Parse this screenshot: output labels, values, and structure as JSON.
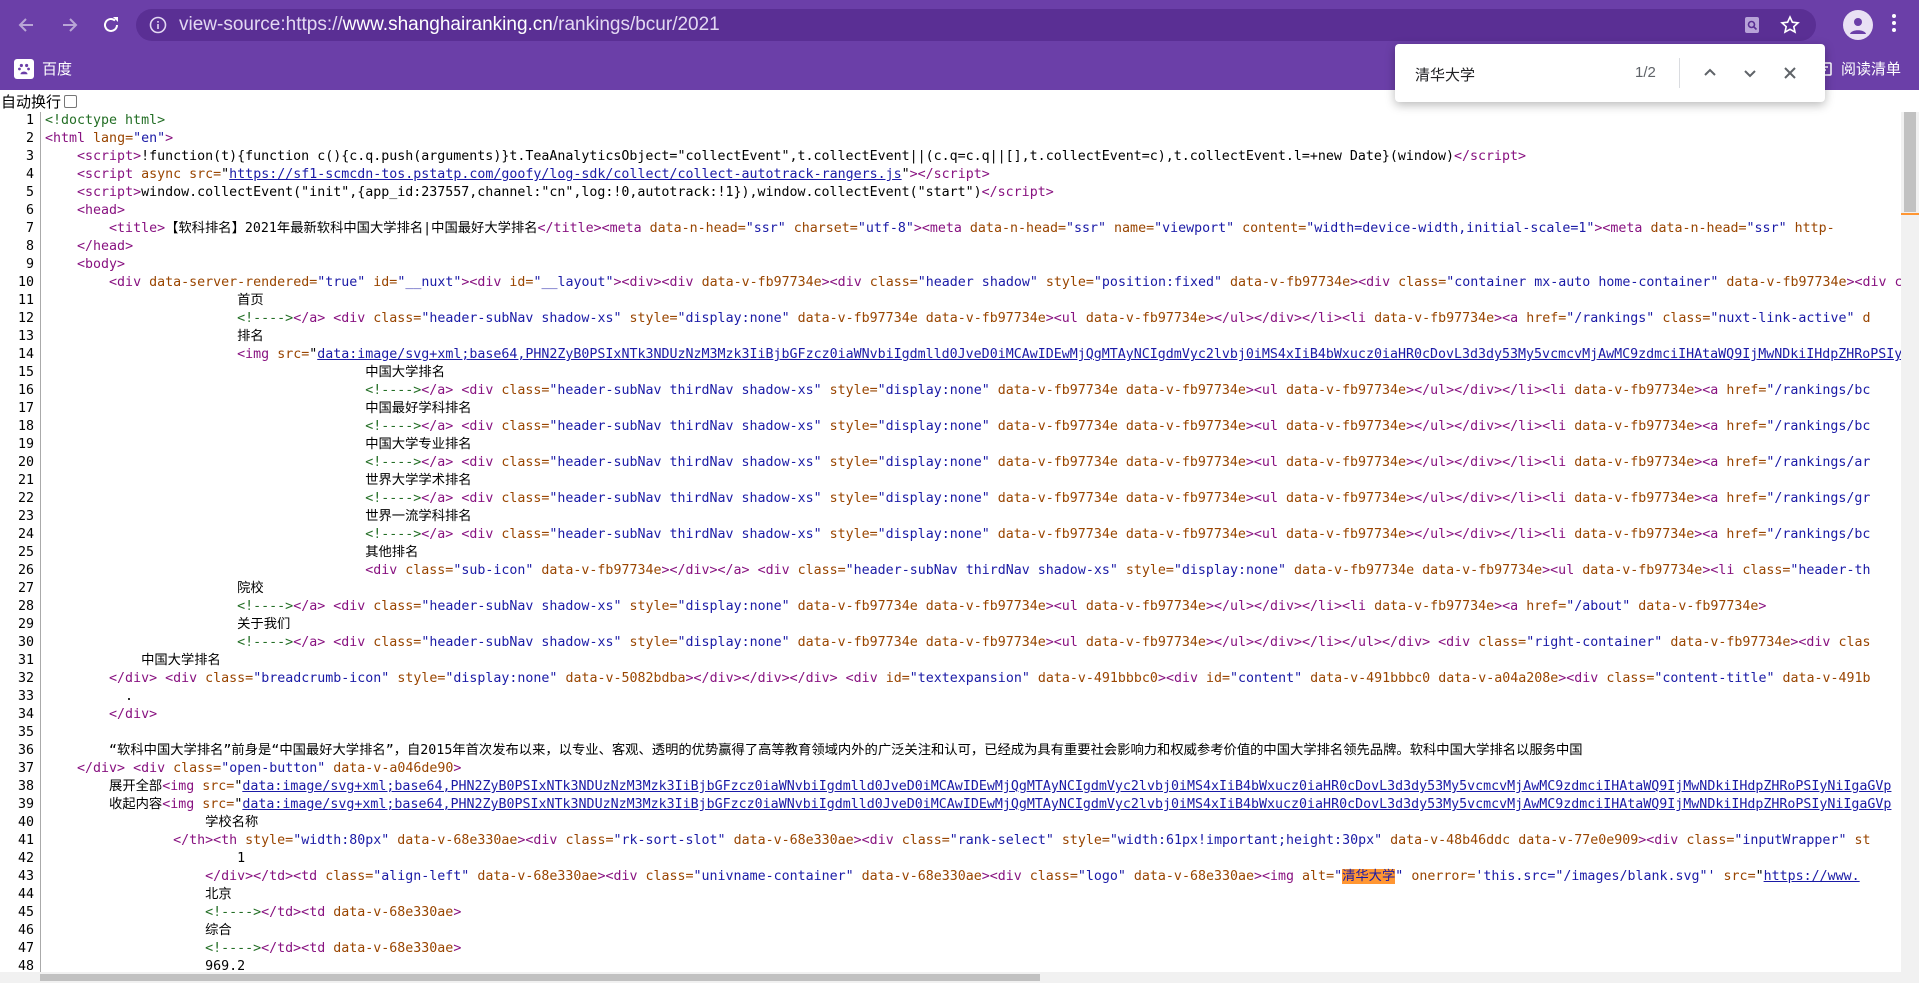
{
  "browser": {
    "url_scheme": "view-source:https://",
    "url_host": "www.shanghairanking.cn",
    "url_path": "/rankings/bcur/2021"
  },
  "bookmarks": {
    "item": "百度",
    "reading_list": "阅读清单"
  },
  "find": {
    "query": "清华大学",
    "count": "1/2"
  },
  "view_source": {
    "wrap_label": "自动换行",
    "lines": [
      {
        "n": "1",
        "html": "<span class=\"cmt\">&lt;!doctype html&gt;</span>"
      },
      {
        "n": "2",
        "html": "<span class=\"tag\">&lt;html</span> <span class=\"attr\">lang=</span><span class=\"val\">\"en\"</span><span class=\"tag\">&gt;</span>"
      },
      {
        "n": "3",
        "html": "    <span class=\"tag\">&lt;script&gt;</span>!function(t){function c(){c.q.push(arguments)}t.TeaAnalyticsObject=\"collectEvent\",t.collectEvent||(c.q=c.q||[],t.collectEvent=c),t.collectEvent.l=+new Date}(window)<span class=\"tag\">&lt;/script&gt;</span>"
      },
      {
        "n": "4",
        "html": "    <span class=\"tag\">&lt;script</span> <span class=\"attr\">async src=</span>\"<span class=\"lnk\">https://sf1-scmcdn-tos.pstatp.com/goofy/log-sdk/collect/collect-autotrack-rangers.js</span>\"<span class=\"tag\">&gt;&lt;/script&gt;</span>"
      },
      {
        "n": "5",
        "html": "    <span class=\"tag\">&lt;script&gt;</span>window.collectEvent(\"init\",{app_id:237557,channel:\"cn\",log:!0,autotrack:!1}),window.collectEvent(\"start\")<span class=\"tag\">&lt;/script&gt;</span>"
      },
      {
        "n": "6",
        "html": "    <span class=\"tag\">&lt;head&gt;</span>"
      },
      {
        "n": "7",
        "html": "        <span class=\"tag\">&lt;title&gt;</span>【软科排名】2021年最新软科中国大学排名|中国最好大学排名<span class=\"tag\">&lt;/title&gt;&lt;meta</span> <span class=\"attr\">data-n-head=</span><span class=\"val\">\"ssr\"</span> <span class=\"attr\">charset=</span><span class=\"val\">\"utf-8\"</span><span class=\"tag\">&gt;&lt;meta</span> <span class=\"attr\">data-n-head=</span><span class=\"val\">\"ssr\"</span> <span class=\"attr\">name=</span><span class=\"val\">\"viewport\"</span> <span class=\"attr\">content=</span><span class=\"val\">\"width=device-width,initial-scale=1\"</span><span class=\"tag\">&gt;&lt;meta</span> <span class=\"attr\">data-n-head=</span><span class=\"val\">\"ssr\"</span> <span class=\"attr\">http-</span>"
      },
      {
        "n": "8",
        "html": "    <span class=\"tag\">&lt;/head&gt;</span>"
      },
      {
        "n": "9",
        "html": "    <span class=\"tag\">&lt;body&gt;</span>"
      },
      {
        "n": "10",
        "html": "        <span class=\"tag\">&lt;div</span> <span class=\"attr\">data-server-rendered=</span><span class=\"val\">\"true\"</span> <span class=\"attr\">id=</span><span class=\"val\">\"__nuxt\"</span><span class=\"tag\">&gt;&lt;div</span> <span class=\"attr\">id=</span><span class=\"val\">\"__layout\"</span><span class=\"tag\">&gt;&lt;div&gt;&lt;div</span> <span class=\"attr\">data-v-fb97734e</span><span class=\"tag\">&gt;&lt;div</span> <span class=\"attr\">class=</span><span class=\"val\">\"header shadow\"</span> <span class=\"attr\">style=</span><span class=\"val\">\"position:fixed\"</span> <span class=\"attr\">data-v-fb97734e</span><span class=\"tag\">&gt;&lt;div</span> <span class=\"attr\">class=</span><span class=\"val\">\"container mx-auto home-container\"</span> <span class=\"attr\">data-v-fb97734e</span><span class=\"tag\">&gt;&lt;div c</span>"
      },
      {
        "n": "11",
        "html": "                        首页"
      },
      {
        "n": "12",
        "html": "                        <span class=\"cmt\">&lt;!----&gt;</span><span class=\"tag\">&lt;/a&gt;</span> <span class=\"tag\">&lt;div</span> <span class=\"attr\">class=</span><span class=\"val\">\"header-subNav shadow-xs\"</span> <span class=\"attr\">style=</span><span class=\"val\">\"display:none\"</span> <span class=\"attr\">data-v-fb97734e data-v-fb97734e</span><span class=\"tag\">&gt;&lt;ul</span> <span class=\"attr\">data-v-fb97734e</span><span class=\"tag\">&gt;&lt;/ul&gt;&lt;/div&gt;&lt;/li&gt;&lt;li</span> <span class=\"attr\">data-v-fb97734e</span><span class=\"tag\">&gt;&lt;a</span> <span class=\"attr\">href=</span><span class=\"val\">\"/rankings\"</span> <span class=\"attr\">class=</span><span class=\"val\">\"nuxt-link-active\"</span> <span class=\"attr\">d</span>"
      },
      {
        "n": "13",
        "html": "                        排名"
      },
      {
        "n": "14",
        "html": "                        <span class=\"tag\">&lt;img</span> <span class=\"attr\">src=</span>\"<span class=\"lnk\">data:image/svg+xml;base64,PHN2ZyB0PSIxNTk3NDUzNzM3Mzk3IiBjbGFzcz0iaWNvbiIgdmlld0JveD0iMCAwIDEwMjQgMTAyNCIgdmVyc2lvbj0iMS4xIiB4bWxucz0iaHR0cDovL3d3dy53My5vcmcvMjAwMC9zdmciIHAtaWQ9IjMwNDkiIHdpZHRoPSIy</span>"
      },
      {
        "n": "15",
        "html": "                                        中国大学排名"
      },
      {
        "n": "16",
        "html": "                                        <span class=\"cmt\">&lt;!----&gt;</span><span class=\"tag\">&lt;/a&gt;</span> <span class=\"tag\">&lt;div</span> <span class=\"attr\">class=</span><span class=\"val\">\"header-subNav thirdNav shadow-xs\"</span> <span class=\"attr\">style=</span><span class=\"val\">\"display:none\"</span> <span class=\"attr\">data-v-fb97734e data-v-fb97734e</span><span class=\"tag\">&gt;&lt;ul</span> <span class=\"attr\">data-v-fb97734e</span><span class=\"tag\">&gt;&lt;/ul&gt;&lt;/div&gt;&lt;/li&gt;&lt;li</span> <span class=\"attr\">data-v-fb97734e</span><span class=\"tag\">&gt;&lt;a</span> <span class=\"attr\">href=</span><span class=\"val\">\"/rankings/bc</span>"
      },
      {
        "n": "17",
        "html": "                                        中国最好学科排名"
      },
      {
        "n": "18",
        "html": "                                        <span class=\"cmt\">&lt;!----&gt;</span><span class=\"tag\">&lt;/a&gt;</span> <span class=\"tag\">&lt;div</span> <span class=\"attr\">class=</span><span class=\"val\">\"header-subNav thirdNav shadow-xs\"</span> <span class=\"attr\">style=</span><span class=\"val\">\"display:none\"</span> <span class=\"attr\">data-v-fb97734e data-v-fb97734e</span><span class=\"tag\">&gt;&lt;ul</span> <span class=\"attr\">data-v-fb97734e</span><span class=\"tag\">&gt;&lt;/ul&gt;&lt;/div&gt;&lt;/li&gt;&lt;li</span> <span class=\"attr\">data-v-fb97734e</span><span class=\"tag\">&gt;&lt;a</span> <span class=\"attr\">href=</span><span class=\"val\">\"/rankings/bc</span>"
      },
      {
        "n": "19",
        "html": "                                        中国大学专业排名"
      },
      {
        "n": "20",
        "html": "                                        <span class=\"cmt\">&lt;!----&gt;</span><span class=\"tag\">&lt;/a&gt;</span> <span class=\"tag\">&lt;div</span> <span class=\"attr\">class=</span><span class=\"val\">\"header-subNav thirdNav shadow-xs\"</span> <span class=\"attr\">style=</span><span class=\"val\">\"display:none\"</span> <span class=\"attr\">data-v-fb97734e data-v-fb97734e</span><span class=\"tag\">&gt;&lt;ul</span> <span class=\"attr\">data-v-fb97734e</span><span class=\"tag\">&gt;&lt;/ul&gt;&lt;/div&gt;&lt;/li&gt;&lt;li</span> <span class=\"attr\">data-v-fb97734e</span><span class=\"tag\">&gt;&lt;a</span> <span class=\"attr\">href=</span><span class=\"val\">\"/rankings/ar</span>"
      },
      {
        "n": "21",
        "html": "                                        世界大学学术排名"
      },
      {
        "n": "22",
        "html": "                                        <span class=\"cmt\">&lt;!----&gt;</span><span class=\"tag\">&lt;/a&gt;</span> <span class=\"tag\">&lt;div</span> <span class=\"attr\">class=</span><span class=\"val\">\"header-subNav thirdNav shadow-xs\"</span> <span class=\"attr\">style=</span><span class=\"val\">\"display:none\"</span> <span class=\"attr\">data-v-fb97734e data-v-fb97734e</span><span class=\"tag\">&gt;&lt;ul</span> <span class=\"attr\">data-v-fb97734e</span><span class=\"tag\">&gt;&lt;/ul&gt;&lt;/div&gt;&lt;/li&gt;&lt;li</span> <span class=\"attr\">data-v-fb97734e</span><span class=\"tag\">&gt;&lt;a</span> <span class=\"attr\">href=</span><span class=\"val\">\"/rankings/gr</span>"
      },
      {
        "n": "23",
        "html": "                                        世界一流学科排名"
      },
      {
        "n": "24",
        "html": "                                        <span class=\"cmt\">&lt;!----&gt;</span><span class=\"tag\">&lt;/a&gt;</span> <span class=\"tag\">&lt;div</span> <span class=\"attr\">class=</span><span class=\"val\">\"header-subNav thirdNav shadow-xs\"</span> <span class=\"attr\">style=</span><span class=\"val\">\"display:none\"</span> <span class=\"attr\">data-v-fb97734e data-v-fb97734e</span><span class=\"tag\">&gt;&lt;ul</span> <span class=\"attr\">data-v-fb97734e</span><span class=\"tag\">&gt;&lt;/ul&gt;&lt;/div&gt;&lt;/li&gt;&lt;li</span> <span class=\"attr\">data-v-fb97734e</span><span class=\"tag\">&gt;&lt;a</span> <span class=\"attr\">href=</span><span class=\"val\">\"/rankings/bc</span>"
      },
      {
        "n": "25",
        "html": "                                        其他排名"
      },
      {
        "n": "26",
        "html": "                                        <span class=\"tag\">&lt;div</span> <span class=\"attr\">class=</span><span class=\"val\">\"sub-icon\"</span> <span class=\"attr\">data-v-fb97734e</span><span class=\"tag\">&gt;&lt;/div&gt;&lt;/a&gt;</span> <span class=\"tag\">&lt;div</span> <span class=\"attr\">class=</span><span class=\"val\">\"header-subNav thirdNav shadow-xs\"</span> <span class=\"attr\">style=</span><span class=\"val\">\"display:none\"</span> <span class=\"attr\">data-v-fb97734e data-v-fb97734e</span><span class=\"tag\">&gt;&lt;ul</span> <span class=\"attr\">data-v-fb97734e</span><span class=\"tag\">&gt;&lt;li</span> <span class=\"attr\">class=</span><span class=\"val\">\"header-th</span>"
      },
      {
        "n": "27",
        "html": "                        院校"
      },
      {
        "n": "28",
        "html": "                        <span class=\"cmt\">&lt;!----&gt;</span><span class=\"tag\">&lt;/a&gt;</span> <span class=\"tag\">&lt;div</span> <span class=\"attr\">class=</span><span class=\"val\">\"header-subNav shadow-xs\"</span> <span class=\"attr\">style=</span><span class=\"val\">\"display:none\"</span> <span class=\"attr\">data-v-fb97734e data-v-fb97734e</span><span class=\"tag\">&gt;&lt;ul</span> <span class=\"attr\">data-v-fb97734e</span><span class=\"tag\">&gt;&lt;/ul&gt;&lt;/div&gt;&lt;/li&gt;&lt;li</span> <span class=\"attr\">data-v-fb97734e</span><span class=\"tag\">&gt;&lt;a</span> <span class=\"attr\">href=</span><span class=\"val\">\"/about\"</span> <span class=\"attr\">data-v-fb97734e</span><span class=\"tag\">&gt;</span>"
      },
      {
        "n": "29",
        "html": "                        关于我们"
      },
      {
        "n": "30",
        "html": "                        <span class=\"cmt\">&lt;!----&gt;</span><span class=\"tag\">&lt;/a&gt;</span> <span class=\"tag\">&lt;div</span> <span class=\"attr\">class=</span><span class=\"val\">\"header-subNav shadow-xs\"</span> <span class=\"attr\">style=</span><span class=\"val\">\"display:none\"</span> <span class=\"attr\">data-v-fb97734e data-v-fb97734e</span><span class=\"tag\">&gt;&lt;ul</span> <span class=\"attr\">data-v-fb97734e</span><span class=\"tag\">&gt;&lt;/ul&gt;&lt;/div&gt;&lt;/li&gt;&lt;/ul&gt;&lt;/div&gt;</span> <span class=\"tag\">&lt;div</span> <span class=\"attr\">class=</span><span class=\"val\">\"right-container\"</span> <span class=\"attr\">data-v-fb97734e</span><span class=\"tag\">&gt;&lt;div</span> <span class=\"attr\">clas</span>"
      },
      {
        "n": "31",
        "html": "            中国大学排名"
      },
      {
        "n": "32",
        "html": "        <span class=\"tag\">&lt;/div&gt;</span> <span class=\"tag\">&lt;div</span> <span class=\"attr\">class=</span><span class=\"val\">\"breadcrumb-icon\"</span> <span class=\"attr\">style=</span><span class=\"val\">\"display:none\"</span> <span class=\"attr\">data-v-5082bdba</span><span class=\"tag\">&gt;&lt;/div&gt;&lt;/div&gt;&lt;/div&gt;</span> <span class=\"tag\">&lt;div</span> <span class=\"attr\">id=</span><span class=\"val\">\"textexpansion\"</span> <span class=\"attr\">data-v-491bbbc0</span><span class=\"tag\">&gt;&lt;div</span> <span class=\"attr\">id=</span><span class=\"val\">\"content\"</span> <span class=\"attr\">data-v-491bbbc0 data-v-a04a208e</span><span class=\"tag\">&gt;&lt;div</span> <span class=\"attr\">class=</span><span class=\"val\">\"content-title\"</span> <span class=\"attr\">data-v-491b</span>"
      },
      {
        "n": "33",
        "html": "          ."
      },
      {
        "n": "34",
        "html": "        <span class=\"tag\">&lt;/div&gt;</span>"
      },
      {
        "n": "35",
        "html": ""
      },
      {
        "n": "36",
        "html": "        “软科中国大学排名”前身是“中国最好大学排名”，自2015年首次发布以来，以专业、客观、透明的优势赢得了高等教育领域内外的广泛关注和认可，已经成为具有重要社会影响力和权威参考价值的中国大学排名领先品牌。软科中国大学排名以服务中国"
      },
      {
        "n": "37",
        "html": "    <span class=\"tag\">&lt;/div&gt;</span> <span class=\"tag\">&lt;div</span> <span class=\"attr\">class=</span><span class=\"val\">\"open-button\"</span> <span class=\"attr\">data-v-a046de90</span><span class=\"tag\">&gt;</span>"
      },
      {
        "n": "38",
        "html": "        展开全部<span class=\"tag\">&lt;img</span> <span class=\"attr\">src=</span>\"<span class=\"lnk\">data:image/svg+xml;base64,PHN2ZyB0PSIxNTk3NDUzNzM3Mzk3IiBjbGFzcz0iaWNvbiIgdmlld0JveD0iMCAwIDEwMjQgMTAyNCIgdmVyc2lvbj0iMS4xIiB4bWxucz0iaHR0cDovL3d3dy53My5vcmcvMjAwMC9zdmciIHAtaWQ9IjMwNDkiIHdpZHRoPSIyNiIgaGVp</span>"
      },
      {
        "n": "39",
        "html": "        收起内容<span class=\"tag\">&lt;img</span> <span class=\"attr\">src=</span>\"<span class=\"lnk\">data:image/svg+xml;base64,PHN2ZyB0PSIxNTk3NDUzNzM3Mzk3IiBjbGFzcz0iaWNvbiIgdmlld0JveD0iMCAwIDEwMjQgMTAyNCIgdmVyc2lvbj0iMS4xIiB4bWxucz0iaHR0cDovL3d3dy53My5vcmcvMjAwMC9zdmciIHAtaWQ9IjMwNDkiIHdpZHRoPSIyNiIgaGVp</span>"
      },
      {
        "n": "40",
        "html": "                    学校名称"
      },
      {
        "n": "41",
        "html": "                <span class=\"tag\">&lt;/th&gt;&lt;th</span> <span class=\"attr\">style=</span><span class=\"val\">\"width:80px\"</span> <span class=\"attr\">data-v-68e330ae</span><span class=\"tag\">&gt;&lt;div</span> <span class=\"attr\">class=</span><span class=\"val\">\"rk-sort-slot\"</span> <span class=\"attr\">data-v-68e330ae</span><span class=\"tag\">&gt;&lt;div</span> <span class=\"attr\">class=</span><span class=\"val\">\"rank-select\"</span> <span class=\"attr\">style=</span><span class=\"val\">\"width:61px!important;height:30px\"</span> <span class=\"attr\">data-v-48b46ddc data-v-77e0e909</span><span class=\"tag\">&gt;&lt;div</span> <span class=\"attr\">class=</span><span class=\"val\">\"inputWrapper\"</span> <span class=\"attr\">st</span>"
      },
      {
        "n": "42",
        "html": "                        1"
      },
      {
        "n": "43",
        "html": "                    <span class=\"tag\">&lt;/div&gt;&lt;/td&gt;&lt;td</span> <span class=\"attr\">class=</span><span class=\"val\">\"align-left\"</span> <span class=\"attr\">data-v-68e330ae</span><span class=\"tag\">&gt;&lt;div</span> <span class=\"attr\">class=</span><span class=\"val\">\"univname-container\"</span> <span class=\"attr\">data-v-68e330ae</span><span class=\"tag\">&gt;&lt;div</span> <span class=\"attr\">class=</span><span class=\"val\">\"logo\"</span> <span class=\"attr\">data-v-68e330ae</span><span class=\"tag\">&gt;&lt;img</span> <span class=\"attr\">alt=</span><span class=\"val\">\"<span class=\"hl\">清华大学</span>\"</span> <span class=\"attr\">onerror=</span><span class=\"val\">'this.src=\"/images/blank.svg\"'</span> <span class=\"attr\">src=</span>\"<span class=\"lnk\">https://www.</span>"
      },
      {
        "n": "44",
        "html": "                    北京"
      },
      {
        "n": "45",
        "html": "                    <span class=\"cmt\">&lt;!----&gt;</span><span class=\"tag\">&lt;/td&gt;&lt;td</span> <span class=\"attr\">data-v-68e330ae</span><span class=\"tag\">&gt;</span>"
      },
      {
        "n": "46",
        "html": "                    综合"
      },
      {
        "n": "47",
        "html": "                    <span class=\"cmt\">&lt;!----&gt;</span><span class=\"tag\">&lt;/td&gt;&lt;td</span> <span class=\"attr\">data-v-68e330ae</span><span class=\"tag\">&gt;</span>"
      },
      {
        "n": "48",
        "html": "                    969.2"
      }
    ]
  }
}
